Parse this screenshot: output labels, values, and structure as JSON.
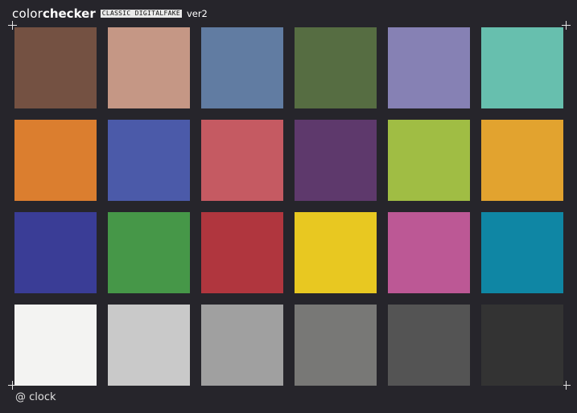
{
  "header": {
    "word1": "color",
    "word2": "checker",
    "badge": "CLASSIC DIGITALFAKE",
    "version": "ver2"
  },
  "footer": "@ clock",
  "patches": [
    "#745142",
    "#c59785",
    "#617ca2",
    "#566d42",
    "#8681b4",
    "#67bfae",
    "#db7e2f",
    "#4b5aa9",
    "#c55a62",
    "#5e396c",
    "#a0bd44",
    "#e2a32f",
    "#3a3d96",
    "#469748",
    "#b0363e",
    "#e8c821",
    "#bc5895",
    "#0f86a4",
    "#f3f3f2",
    "#c9c9c9",
    "#a0a0a0",
    "#787876",
    "#545454",
    "#333333"
  ]
}
